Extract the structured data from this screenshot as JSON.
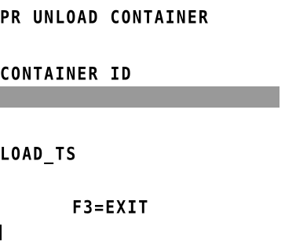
{
  "screen": {
    "title": "PR UNLOAD CONTAINER",
    "container_id_label": "CONTAINER ID",
    "container_id_value": "",
    "load_ts_label": "LOAD_TS",
    "f3_exit": "F3=EXIT"
  },
  "colors": {
    "background": "#ffffff",
    "text": "#000000",
    "input_field": "#999999"
  }
}
